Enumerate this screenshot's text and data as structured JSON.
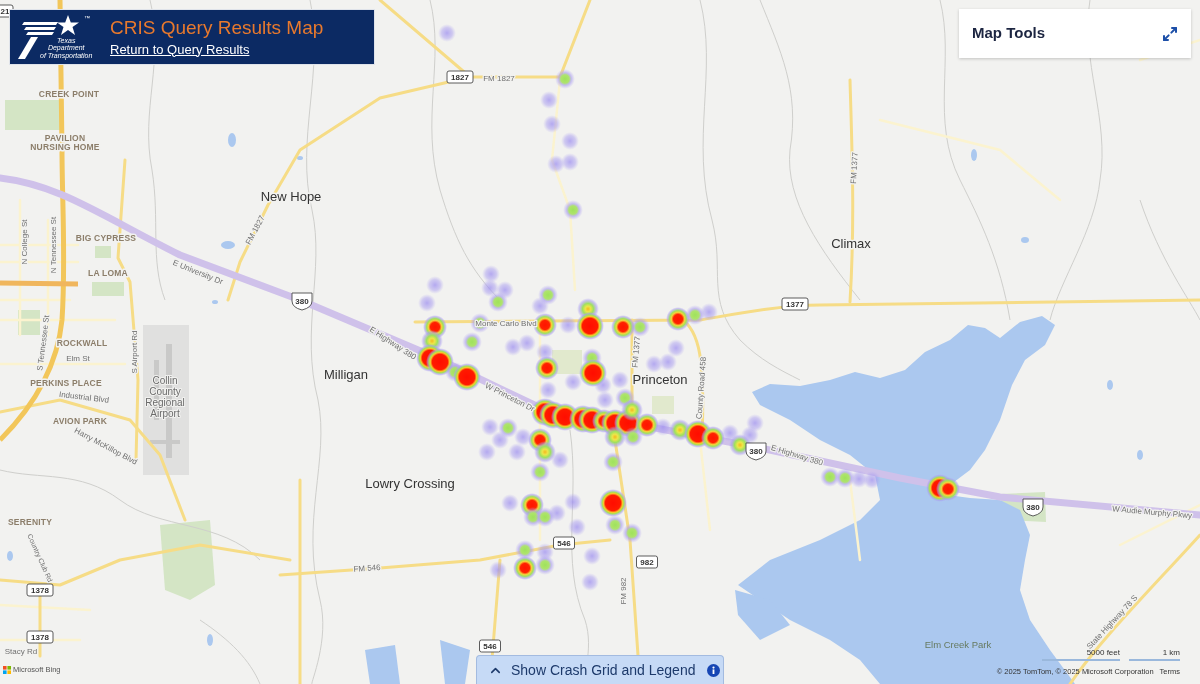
{
  "header": {
    "logo": {
      "lines": [
        "Texas",
        "Department",
        "of Transportation"
      ],
      "trademark": "™"
    },
    "title": "CRIS Query Results Map",
    "link": "Return to Query Results"
  },
  "map_tools": {
    "title": "Map Tools"
  },
  "map": {
    "labels": [
      {
        "kind": "shield",
        "text": "21"
      },
      {
        "kind": "shield",
        "text": "1827"
      },
      {
        "kind": "road",
        "text": "FM 1827"
      },
      {
        "kind": "town",
        "text": "New Hope"
      },
      {
        "kind": "road",
        "text": "FM 1827"
      },
      {
        "kind": "town",
        "text": "Climax"
      },
      {
        "kind": "road",
        "text": "FM 1377"
      },
      {
        "kind": "neighborhood",
        "text": "CREEK POINT"
      },
      {
        "kind": "neighborhood",
        "lines": [
          "PAVILION",
          "NURSING HOME"
        ]
      },
      {
        "kind": "neighborhood",
        "text": "BIG CYPRESS"
      },
      {
        "kind": "neighborhood",
        "text": "LA LOMA"
      },
      {
        "kind": "road",
        "text": "N College St"
      },
      {
        "kind": "road",
        "text": "N Tennessee St"
      },
      {
        "kind": "road",
        "text": "E University Dr"
      },
      {
        "kind": "us_shield",
        "text": "380"
      },
      {
        "kind": "shield",
        "text": "1377"
      },
      {
        "kind": "road",
        "text": "Monte Carlo Blvd"
      },
      {
        "kind": "road",
        "text": "E Highway 380"
      },
      {
        "kind": "town",
        "text": "Milligan"
      },
      {
        "kind": "road",
        "text": "W Princeton Dr"
      },
      {
        "kind": "road",
        "text": "FM 1377"
      },
      {
        "kind": "town",
        "text": "Princeton"
      },
      {
        "kind": "road",
        "text": "County Road 458"
      },
      {
        "kind": "neighborhood",
        "text": "ROCKWALL"
      },
      {
        "kind": "road",
        "text": "Elm St"
      },
      {
        "kind": "road",
        "text": "S Tennessee St"
      },
      {
        "kind": "road",
        "text": "S Airport Rd"
      },
      {
        "kind": "neighborhood",
        "text": "PERKINS PLACE"
      },
      {
        "kind": "road",
        "text": "Industrial Blvd"
      },
      {
        "kind": "poi",
        "lines": [
          "Collin",
          "County",
          "Regional",
          "Airport"
        ]
      },
      {
        "kind": "neighborhood",
        "text": "AVION PARK"
      },
      {
        "kind": "road",
        "text": "Harry McKillop Blvd"
      },
      {
        "kind": "us_shield",
        "text": "380"
      },
      {
        "kind": "road",
        "text": "E Highway 380"
      },
      {
        "kind": "town",
        "text": "Lowry Crossing"
      },
      {
        "kind": "us_shield",
        "text": "380"
      },
      {
        "kind": "road",
        "text": "W Audie Murphy Pkwy"
      },
      {
        "kind": "neighborhood",
        "text": "SERENITY"
      },
      {
        "kind": "shield",
        "text": "546"
      },
      {
        "kind": "road",
        "text": "FM 546"
      },
      {
        "kind": "shield",
        "text": "982"
      },
      {
        "kind": "road",
        "text": "Country Club Rd"
      },
      {
        "kind": "road",
        "text": "FM 982"
      },
      {
        "kind": "shield",
        "text": "1378"
      },
      {
        "kind": "road",
        "text": "State Highway 78 S"
      },
      {
        "kind": "shield",
        "text": "1378"
      },
      {
        "kind": "park",
        "text": "Elm Creek Park"
      },
      {
        "kind": "shield",
        "text": "546"
      },
      {
        "kind": "road",
        "text": "Stacy Rd"
      }
    ]
  },
  "legend_toggle": {
    "label": "Show Crash Grid and Legend"
  },
  "attribution": {
    "logo_text": "Microsoft Bing",
    "scale": [
      {
        "label": "5000 feet"
      },
      {
        "label": "1 km"
      }
    ],
    "copyright": "© 2025 TomTom, © 2025 Microsoft Corporation",
    "terms": "Terms"
  }
}
